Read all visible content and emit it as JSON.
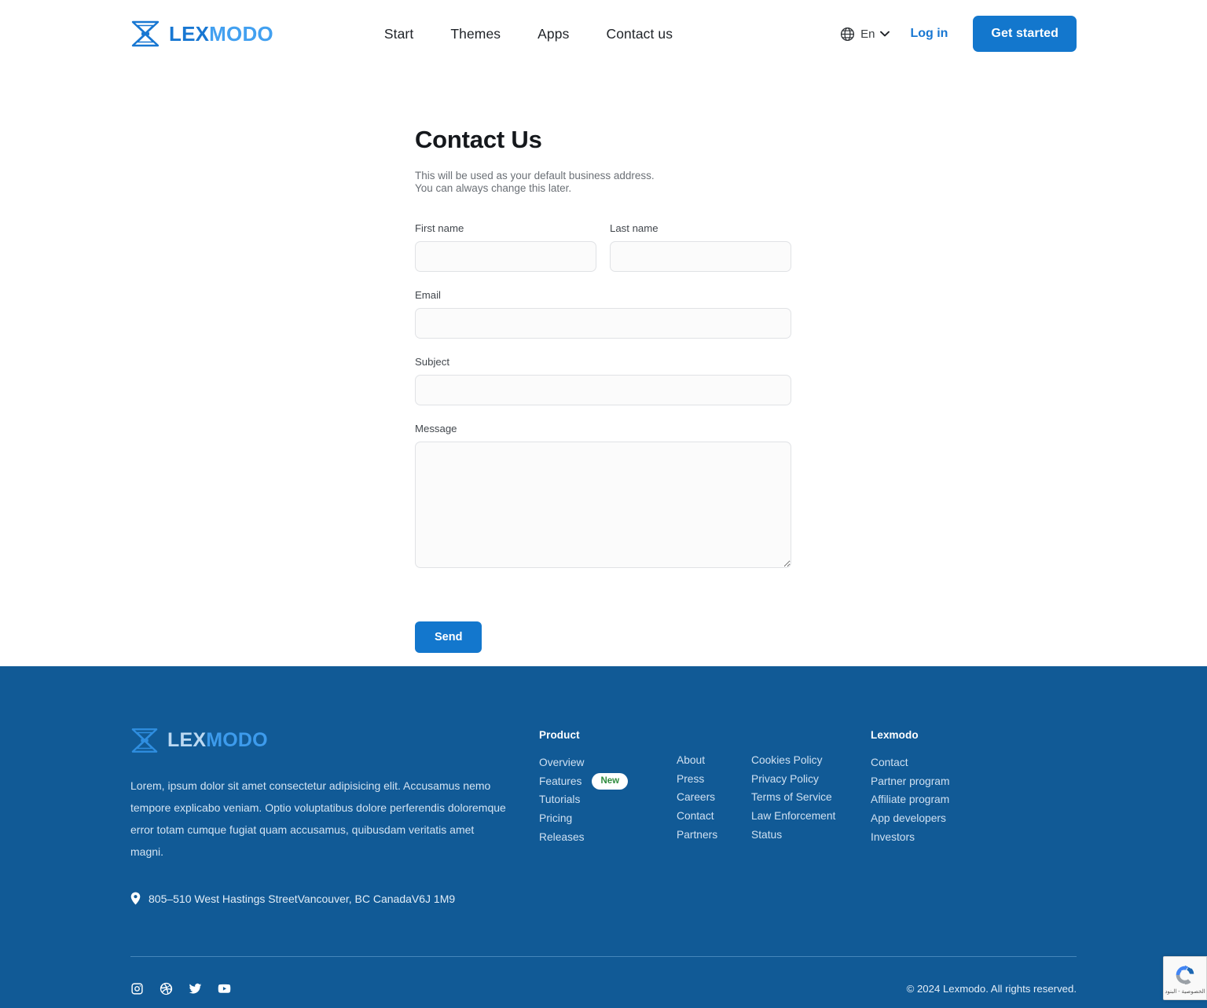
{
  "header": {
    "brand": {
      "part1": "LEX",
      "part2": "MODO",
      "logo_icon": "hourglass-logo-icon"
    },
    "nav": [
      {
        "label": "Start"
      },
      {
        "label": "Themes"
      },
      {
        "label": "Apps"
      },
      {
        "label": "Contact us"
      }
    ],
    "language": {
      "label": "En",
      "globe_icon": "globe-icon",
      "chevron_icon": "chevron-down-icon"
    },
    "login_label": "Log in",
    "get_started_label": "Get started",
    "accent_color": "#1377cd"
  },
  "main": {
    "title": "Contact Us",
    "subtitle": "This will be used as your default business address.\nYou can always change this later.",
    "fields": {
      "first_name": {
        "label": "First name",
        "value": "",
        "placeholder": ""
      },
      "last_name": {
        "label": "Last name",
        "value": "",
        "placeholder": ""
      },
      "email": {
        "label": "Email",
        "value": "",
        "placeholder": ""
      },
      "subject": {
        "label": "Subject",
        "value": "",
        "placeholder": ""
      },
      "message": {
        "label": "Message",
        "value": "",
        "placeholder": ""
      }
    },
    "send_label": "Send"
  },
  "footer": {
    "background_color": "#115a96",
    "brand": {
      "part1": "LEX",
      "part2": "MODO",
      "logo_icon": "hourglass-logo-icon"
    },
    "description": "Lorem, ipsum dolor sit amet consectetur adipisicing elit. Accusamus nemo tempore explicabo veniam. Optio voluptatibus dolore perferendis doloremque error totam cumque fugiat quam accusamus, quibusdam veritatis amet magni.",
    "address": "805–510 West Hastings StreetVancouver, BC CanadaV6J 1M9",
    "address_icon": "location-pin-icon",
    "columns": [
      {
        "title": "Product",
        "links": [
          {
            "label": "Overview"
          },
          {
            "label": "Features",
            "badge": "New"
          },
          {
            "label": "Tutorials"
          },
          {
            "label": "Pricing"
          },
          {
            "label": "Releases"
          }
        ]
      },
      {
        "title": "",
        "links": [
          {
            "label": "About"
          },
          {
            "label": "Press"
          },
          {
            "label": "Careers"
          },
          {
            "label": "Contact"
          },
          {
            "label": "Partners"
          }
        ]
      },
      {
        "title": "",
        "links": [
          {
            "label": "Cookies Policy"
          },
          {
            "label": "Privacy Policy"
          },
          {
            "label": "Terms of Service"
          },
          {
            "label": "Law Enforcement"
          },
          {
            "label": "Status"
          }
        ]
      },
      {
        "title": "Lexmodo",
        "links": [
          {
            "label": "Contact"
          },
          {
            "label": "Partner program"
          },
          {
            "label": "Affiliate program"
          },
          {
            "label": "App developers"
          },
          {
            "label": "Investors"
          }
        ]
      }
    ],
    "socials": [
      {
        "name": "instagram-icon"
      },
      {
        "name": "dribbble-icon"
      },
      {
        "name": "twitter-icon"
      },
      {
        "name": "youtube-icon"
      }
    ],
    "copyright": "© 2024 Lexmodo. All rights reserved."
  },
  "recaptcha": {
    "text": "الخصوصية - البنود",
    "icon": "recaptcha-icon"
  }
}
